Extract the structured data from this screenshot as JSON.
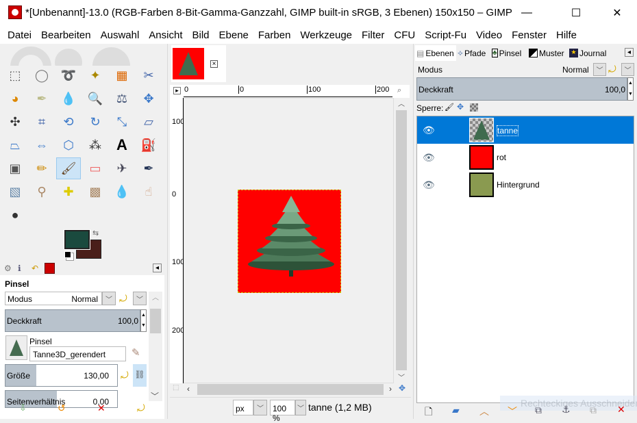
{
  "window": {
    "title": "*[Unbenannt]-13.0 (RGB-Farben 8-Bit-Gamma-Ganzzahl, GIMP built-in sRGB, 3 Ebenen) 150x150 – GIMP",
    "minimize": "—",
    "maximize": "☐",
    "close": "✕"
  },
  "menu": [
    "Datei",
    "Bearbeiten",
    "Auswahl",
    "Ansicht",
    "Bild",
    "Ebene",
    "Farben",
    "Werkzeuge",
    "Filter",
    "CFU",
    "Script-Fu",
    "Video",
    "Fenster",
    "Hilfe"
  ],
  "colors": {
    "foreground": "#1a4a3e",
    "background": "#4a1f1a",
    "accent": "#0078d7",
    "image_bg": "#ff0000",
    "layer_bg": "#8a9a50"
  },
  "tools": [
    "rect-select",
    "ellipse-select",
    "free-select",
    "fuzzy-select",
    "select-by-color",
    "scissors",
    "foreground-select",
    "paths",
    "color-picker",
    "zoom",
    "measure",
    "move",
    "align",
    "crop",
    "unified-transform",
    "rotate",
    "scale",
    "shear",
    "perspective",
    "flip",
    "cage",
    "warp",
    "text",
    "bucket-fill",
    "gradient",
    "pencil",
    "paintbrush",
    "eraser",
    "airbrush",
    "ink",
    "mypaint",
    "clone",
    "heal",
    "perspective-clone",
    "blur",
    "smudge",
    "dodge-burn"
  ],
  "tool_options": {
    "title": "Pinsel",
    "mode_label": "Modus",
    "mode_value": "Normal",
    "opacity_label": "Deckkraft",
    "opacity_value": "100,0",
    "brush_label": "Pinsel",
    "brush_value": "Tanne3D_gerendert",
    "size_label": "Größe",
    "size_value": "130,00",
    "aspect_label": "Seitenverhältnis",
    "aspect_value": "0,00"
  },
  "canvas": {
    "ruler_h": [
      "0",
      "0",
      "100",
      "200"
    ],
    "ruler_v": [
      "100",
      "0",
      "100",
      "200"
    ],
    "unit": "px",
    "zoom": "100 %",
    "status": "tanne (1,2 MB)"
  },
  "layers_panel": {
    "tabs": [
      "Ebenen",
      "Pfade",
      "Pinsel",
      "Muster",
      "Journal"
    ],
    "mode_label": "Modus",
    "mode_value": "Normal",
    "opacity_label": "Deckkraft",
    "opacity_value": "100,0",
    "lock_label": "Sperre:",
    "layers": [
      {
        "name": "tanne",
        "selected": true
      },
      {
        "name": "rot",
        "selected": false
      },
      {
        "name": "Hintergrund",
        "selected": false
      }
    ],
    "ghost_tooltip": "Rechteckiges Ausschneiden"
  }
}
